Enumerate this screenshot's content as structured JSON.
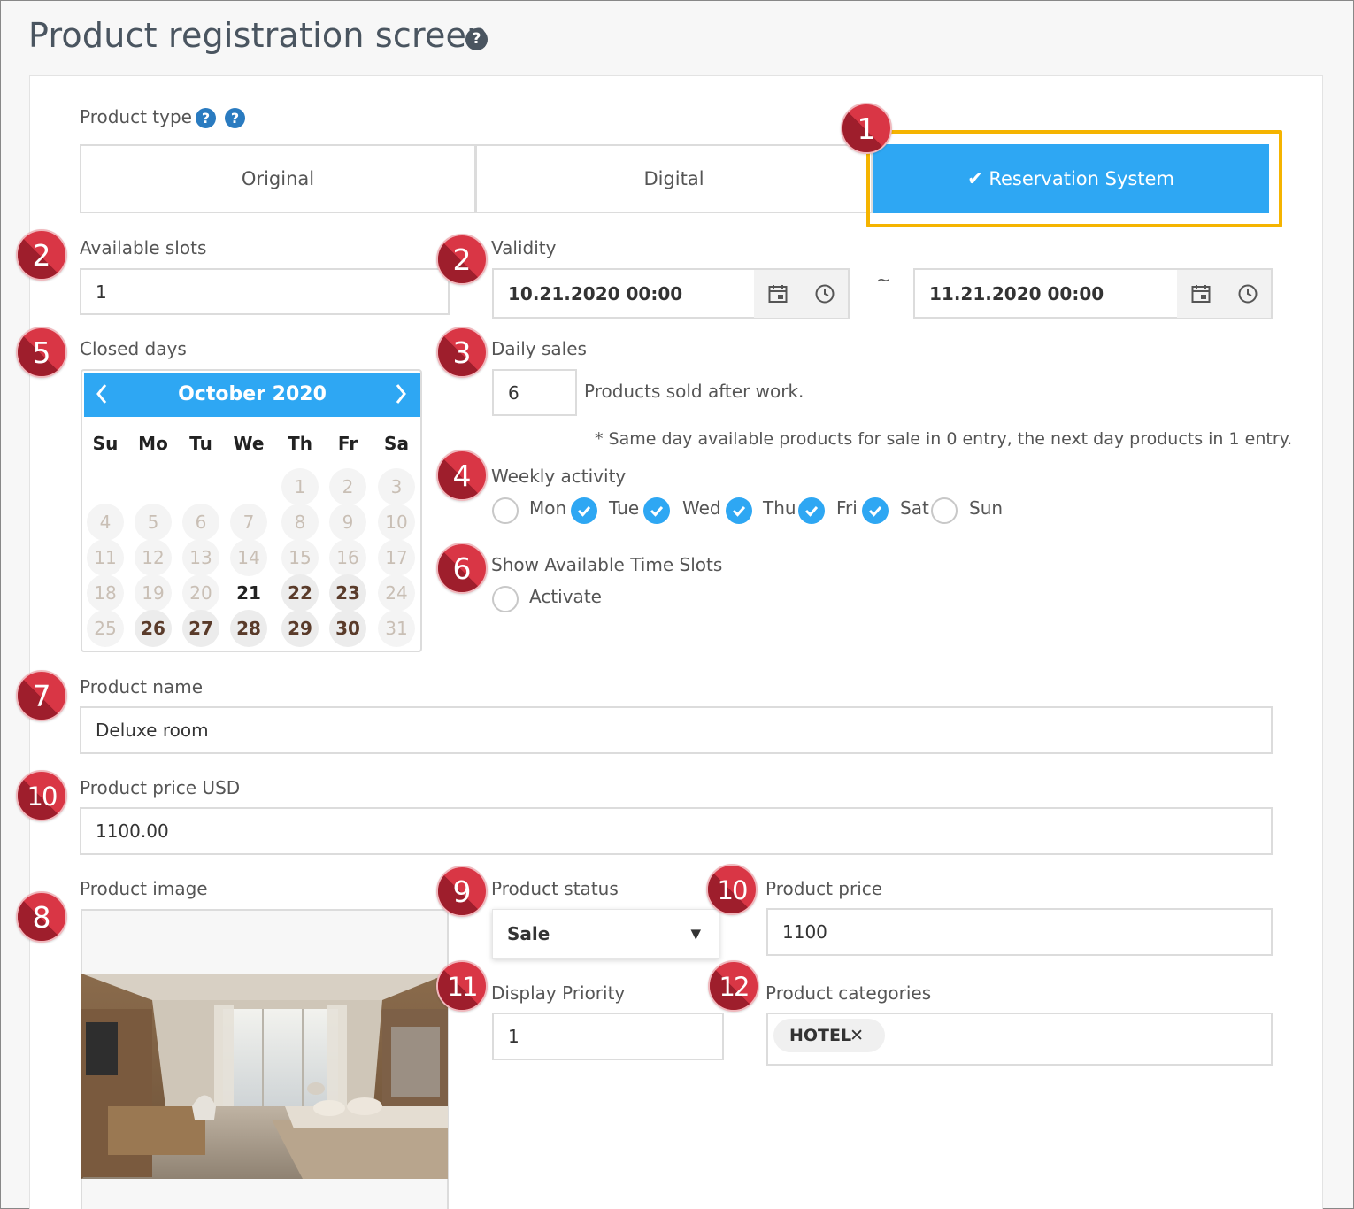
{
  "page": {
    "title": "Product registration screen",
    "help_glyph": "?"
  },
  "product_type": {
    "label": "Product type",
    "help_glyph": "?",
    "options": [
      "Original",
      "Digital",
      "Reservation System"
    ],
    "selected": "Reservation System",
    "check_glyph": "✔"
  },
  "badges": [
    "1",
    "2",
    "2",
    "3",
    "4",
    "5",
    "6",
    "7",
    "8",
    "9",
    "10",
    "10",
    "11",
    "12"
  ],
  "available_slots": {
    "label": "Available slots",
    "value": "1"
  },
  "validity": {
    "label": "Validity",
    "start": "10.21.2020 00:00",
    "end": "11.21.2020 00:00",
    "separator": "~"
  },
  "closed_days": {
    "label": "Closed days",
    "calendar": {
      "title": "October 2020",
      "prev": "‹",
      "next": "›",
      "weekdays": [
        "Su",
        "Mo",
        "Tu",
        "We",
        "Th",
        "Fr",
        "Sa"
      ],
      "days": [
        "1",
        "2",
        "3",
        "4",
        "5",
        "6",
        "7",
        "8",
        "9",
        "10",
        "11",
        "12",
        "13",
        "14",
        "15",
        "16",
        "17",
        "18",
        "19",
        "20",
        "21",
        "22",
        "23",
        "24",
        "25",
        "26",
        "27",
        "28",
        "29",
        "30",
        "31"
      ],
      "today": "21",
      "selected": [
        "22",
        "23",
        "26",
        "27",
        "28",
        "29",
        "30"
      ]
    }
  },
  "daily_sales": {
    "label": "Daily sales",
    "value": "6",
    "suffix": "Products sold after work.",
    "note": "* Same day available products for sale in 0 entry, the next day products in 1 entry."
  },
  "weekly_activity": {
    "label": "Weekly activity",
    "days": [
      {
        "label": "Mon",
        "checked": false
      },
      {
        "label": "Tue",
        "checked": true
      },
      {
        "label": "Wed",
        "checked": true
      },
      {
        "label": "Thu",
        "checked": true
      },
      {
        "label": "Fri",
        "checked": true
      },
      {
        "label": "Sat",
        "checked": true
      },
      {
        "label": "Sun",
        "checked": false
      }
    ]
  },
  "time_slots": {
    "label": "Show Available Time Slots",
    "option": "Activate",
    "checked": false
  },
  "product_name": {
    "label": "Product name",
    "value": "Deluxe room"
  },
  "product_price_usd": {
    "label": "Product price USD",
    "value": "1100.00"
  },
  "product_image": {
    "label": "Product image"
  },
  "product_status": {
    "label": "Product status",
    "value": "Sale",
    "caret": "▼"
  },
  "product_price": {
    "label": "Product price",
    "value": "1100"
  },
  "display_priority": {
    "label": "Display Priority",
    "value": "1"
  },
  "product_categories": {
    "label": "Product categories",
    "tags": [
      "HOTEL"
    ],
    "remove_glyph": "✕"
  },
  "colors": {
    "accent": "#2ea7f3",
    "highlight": "#f5b400",
    "badge": "#d93645"
  }
}
